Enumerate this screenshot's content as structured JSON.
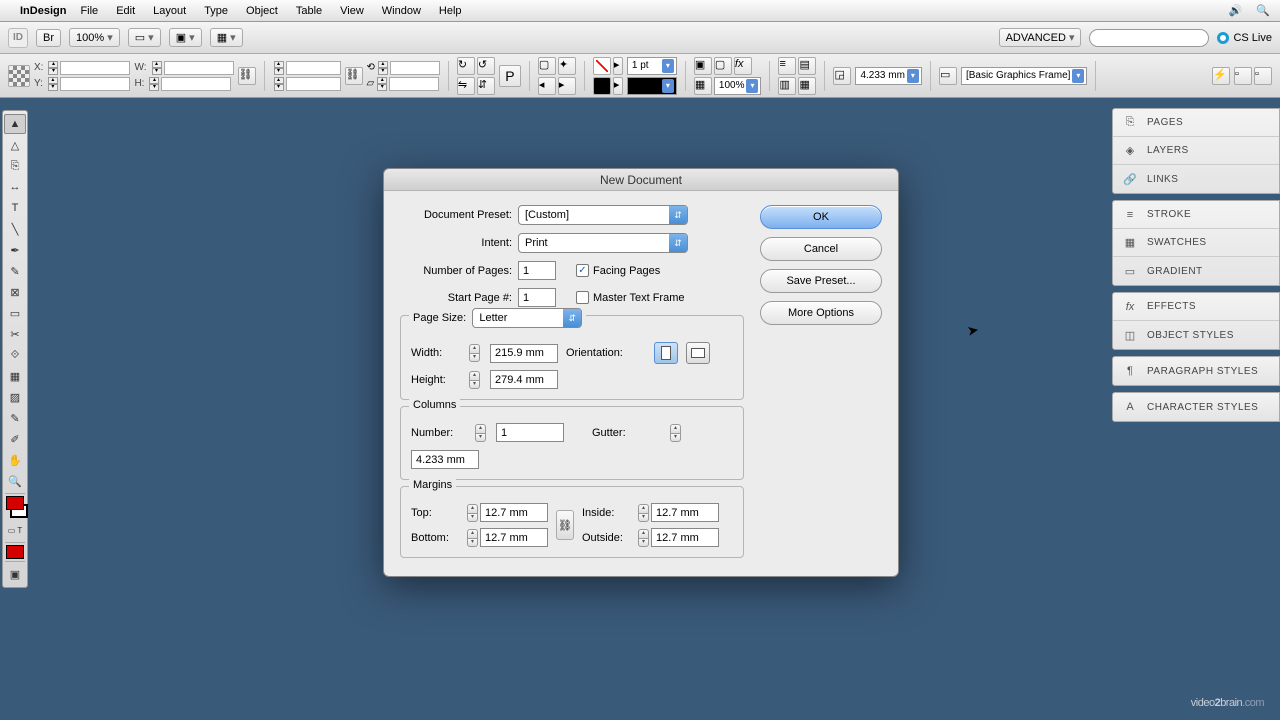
{
  "menubar": {
    "appname": "InDesign",
    "items": [
      "File",
      "Edit",
      "Layout",
      "Type",
      "Object",
      "Table",
      "View",
      "Window",
      "Help"
    ]
  },
  "appbar": {
    "zoom": "100%",
    "workspace": "ADVANCED",
    "cslive": "CS Live"
  },
  "ctrl": {
    "x_label": "X:",
    "y_label": "Y:",
    "w_label": "W:",
    "h_label": "H:",
    "stroke_weight": "1 pt",
    "opacity": "100%",
    "corner": "4.233 mm",
    "style": "[Basic Graphics Frame]"
  },
  "panels": {
    "g1": [
      "PAGES",
      "LAYERS",
      "LINKS"
    ],
    "g2": [
      "STROKE",
      "SWATCHES",
      "GRADIENT"
    ],
    "g3": [
      "EFFECTS",
      "OBJECT STYLES"
    ],
    "g4": [
      "PARAGRAPH STYLES"
    ],
    "g5": [
      "CHARACTER STYLES"
    ]
  },
  "dialog": {
    "title": "New Document",
    "labels": {
      "preset": "Document Preset:",
      "intent": "Intent:",
      "numpages": "Number of Pages:",
      "startpage": "Start Page #:",
      "facing": "Facing Pages",
      "master": "Master Text Frame",
      "pagesize": "Page Size:",
      "width": "Width:",
      "height": "Height:",
      "orientation": "Orientation:",
      "columns": "Columns",
      "number": "Number:",
      "gutter": "Gutter:",
      "margins": "Margins",
      "top": "Top:",
      "bottom": "Bottom:",
      "inside": "Inside:",
      "outside": "Outside:"
    },
    "values": {
      "preset": "[Custom]",
      "intent": "Print",
      "numpages": "1",
      "startpage": "1",
      "facing": true,
      "master": false,
      "pagesize": "Letter",
      "width": "215.9 mm",
      "height": "279.4 mm",
      "col_number": "1",
      "gutter": "4.233 mm",
      "top": "12.7 mm",
      "bottom": "12.7 mm",
      "inside": "12.7 mm",
      "outside": "12.7 mm"
    },
    "buttons": {
      "ok": "OK",
      "cancel": "Cancel",
      "save": "Save Preset...",
      "more": "More Options"
    }
  },
  "watermark": {
    "a": "video",
    "b": "2",
    "c": "brain",
    "d": ".com"
  }
}
